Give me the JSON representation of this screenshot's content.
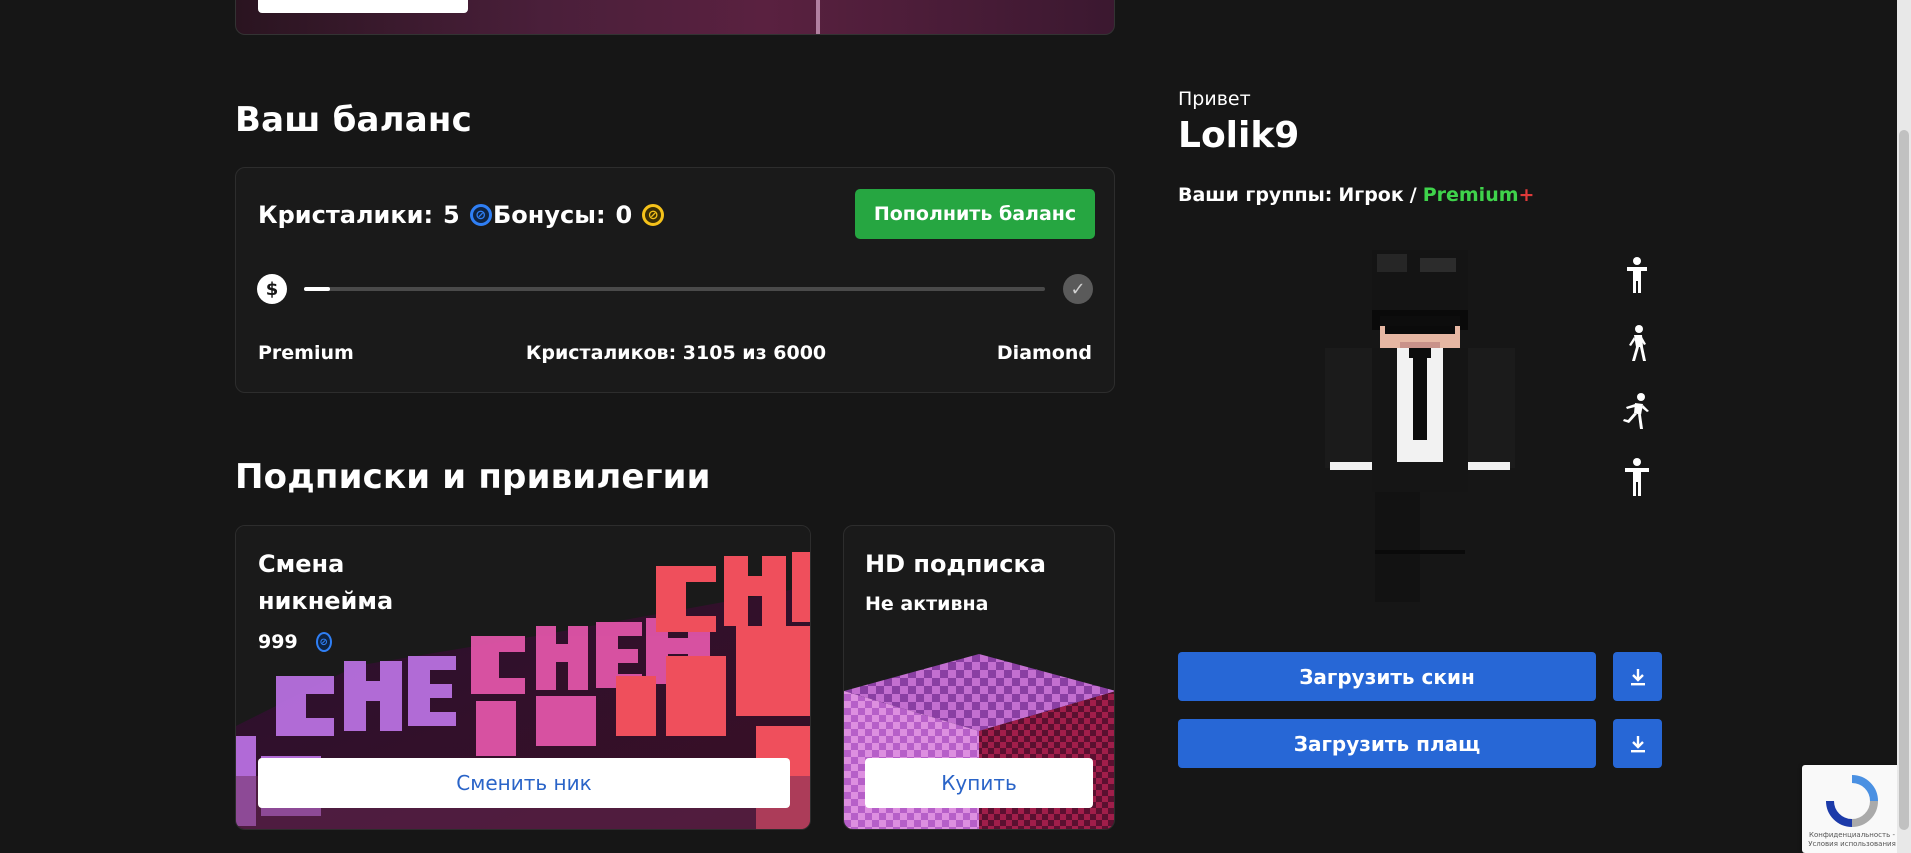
{
  "balance": {
    "heading": "Ваш баланс",
    "crystals_label": "Кристалики:",
    "crystals_value": "5",
    "bonuses_label": "Бонусы:",
    "bonuses_value": "0",
    "topup_button": "Пополнить баланс",
    "progress": {
      "current_rank": "Premium",
      "next_rank": "Diamond",
      "status_text": "Кристаликов: 3105 из 6000",
      "fraction": 0.0345
    }
  },
  "subscriptions": {
    "heading": "Подписки и привилегии",
    "items": [
      {
        "title_line1": "Смена",
        "title_line2": "никнейма",
        "price": "999",
        "button": "Сменить ник"
      },
      {
        "title": "HD подписка",
        "status": "Не активна",
        "button": "Купить"
      }
    ]
  },
  "profile": {
    "greeting": "Привет",
    "username": "Lolik9",
    "groups_label": "Ваши группы:",
    "group_player": "Игрок",
    "separator": "/",
    "group_premium": "Premium",
    "premium_plus": "+",
    "upload_skin": "Загрузить скин",
    "upload_cape": "Загрузить плащ"
  },
  "recaptcha": {
    "text": "Конфиденциальность - Условия использования"
  },
  "colors": {
    "accent_green": "#26a641",
    "accent_blue": "#2767d6",
    "premium_green": "#3fd34b",
    "crystal_blue": "#2f7ff5",
    "bonus_gold": "#f5c21a"
  },
  "icons": [
    "dollar-icon",
    "check-icon",
    "crystal-icon",
    "bonus-coin-icon",
    "download-icon",
    "pose-stand-icon",
    "pose-walk-icon",
    "pose-run-icon",
    "pose-tpose-icon",
    "recaptcha-icon"
  ]
}
